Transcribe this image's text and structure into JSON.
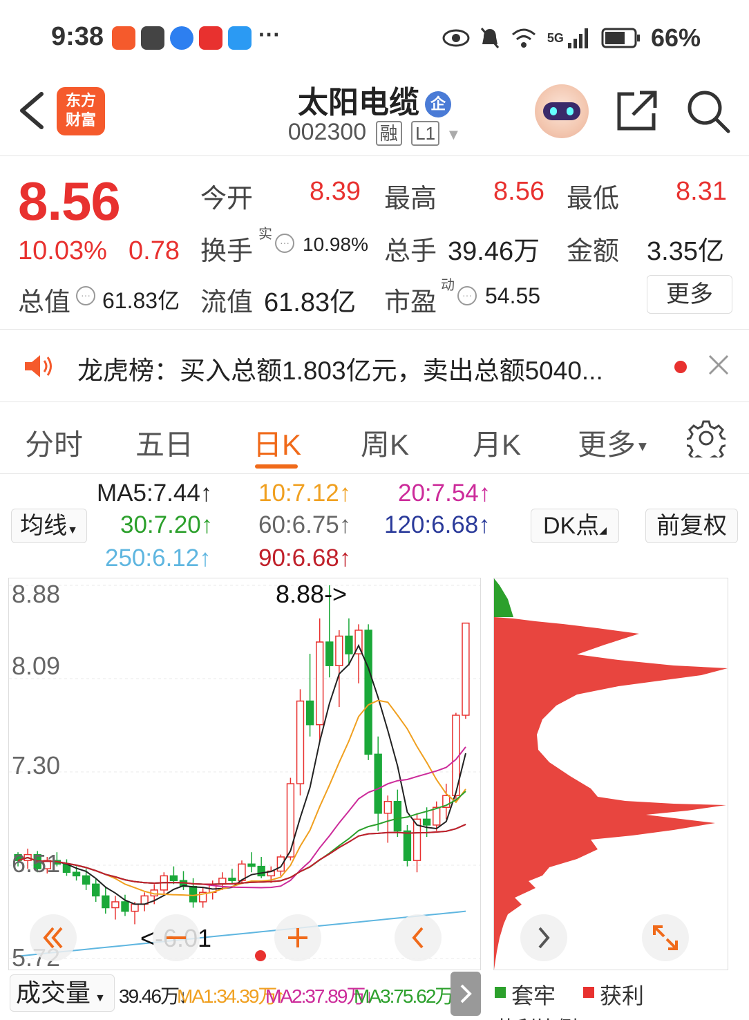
{
  "status_bar": {
    "time": "9:38",
    "battery": "66%",
    "network": "5G",
    "more": "···"
  },
  "header": {
    "app_logo_line1": "东方",
    "app_logo_line2": "财富",
    "stock_name": "太阳电缆",
    "enterprise_badge": "企",
    "stock_code": "002300",
    "margin_tag": "融",
    "level_tag": "L1"
  },
  "quote": {
    "price": "8.56",
    "change_pct": "10.03%",
    "change_amt": "0.78",
    "open_label": "今开",
    "open": "8.39",
    "high_label": "最高",
    "high": "8.56",
    "low_label": "最低",
    "low": "8.31",
    "turnover_label": "换手",
    "turnover_sup": "实",
    "turnover": "10.98%",
    "volume_label": "总手",
    "volume": "39.46万",
    "amount_label": "金额",
    "amount": "3.35亿",
    "total_cap_label": "总值",
    "total_cap": "61.83亿",
    "float_cap_label": "流值",
    "float_cap": "61.83亿",
    "pe_label": "市盈",
    "pe_sup": "动",
    "pe": "54.55",
    "more_label": "更多"
  },
  "news": {
    "text": "龙虎榜：买入总额1.803亿元，卖出总额5040..."
  },
  "tabs": [
    {
      "label": "分时"
    },
    {
      "label": "五日"
    },
    {
      "label": "日K"
    },
    {
      "label": "周K"
    },
    {
      "label": "月K"
    },
    {
      "label": "更多"
    }
  ],
  "indicators": {
    "ma_select": "均线",
    "ma5": "MA5:7.44↑",
    "ma10": "10:7.12↑",
    "ma20": "20:7.54↑",
    "ma30": "30:7.20↑",
    "ma60": "60:6.75↑",
    "ma120": "120:6.68↑",
    "ma250": "250:6.12↑",
    "ma90": "90:6.68↑",
    "dk_button": "DK点",
    "adjust_button": "前复权"
  },
  "colors": {
    "up": "#e8312f",
    "down": "#1aa839",
    "accent": "#f06a1a",
    "ma5": "#222222",
    "ma10": "#f0a020",
    "ma20": "#cc2b9a",
    "ma30": "#2ca02c",
    "ma60": "#666666",
    "ma120": "#2a3a9a",
    "ma250": "#5fb6e0",
    "ma90": "#c0202a"
  },
  "chart_data": {
    "type": "candlestick",
    "y_ticks": [
      "8.88",
      "8.09",
      "7.30",
      "6.51",
      "5.72"
    ],
    "ylim": [
      5.72,
      8.88
    ],
    "max_marker": "8.88->",
    "min_marker": "<-6.01",
    "candles": [
      [
        6.6,
        6.62,
        6.5,
        6.55
      ],
      [
        6.55,
        6.65,
        6.48,
        6.6
      ],
      [
        6.6,
        6.63,
        6.45,
        6.48
      ],
      [
        6.48,
        6.58,
        6.44,
        6.55
      ],
      [
        6.55,
        6.62,
        6.5,
        6.52
      ],
      [
        6.52,
        6.56,
        6.42,
        6.45
      ],
      [
        6.45,
        6.5,
        6.38,
        6.42
      ],
      [
        6.42,
        6.48,
        6.3,
        6.35
      ],
      [
        6.35,
        6.4,
        6.2,
        6.25
      ],
      [
        6.25,
        6.32,
        6.1,
        6.15
      ],
      [
        6.15,
        6.25,
        6.05,
        6.2
      ],
      [
        6.2,
        6.26,
        6.08,
        6.12
      ],
      [
        6.12,
        6.2,
        6.01,
        6.18
      ],
      [
        6.18,
        6.28,
        6.12,
        6.25
      ],
      [
        6.25,
        6.35,
        6.18,
        6.3
      ],
      [
        6.3,
        6.45,
        6.25,
        6.42
      ],
      [
        6.42,
        6.5,
        6.35,
        6.38
      ],
      [
        6.38,
        6.46,
        6.3,
        6.33
      ],
      [
        6.33,
        6.4,
        6.15,
        6.2
      ],
      [
        6.2,
        6.32,
        6.15,
        6.28
      ],
      [
        6.28,
        6.38,
        6.22,
        6.35
      ],
      [
        6.35,
        6.45,
        6.3,
        6.4
      ],
      [
        6.4,
        6.48,
        6.35,
        6.38
      ],
      [
        6.38,
        6.55,
        6.35,
        6.52
      ],
      [
        6.52,
        6.62,
        6.45,
        6.5
      ],
      [
        6.5,
        6.58,
        6.4,
        6.42
      ],
      [
        6.42,
        6.5,
        6.36,
        6.46
      ],
      [
        6.46,
        6.6,
        6.42,
        6.58
      ],
      [
        6.58,
        7.25,
        6.55,
        7.2
      ],
      [
        7.2,
        8.0,
        7.1,
        7.9
      ],
      [
        7.9,
        8.3,
        7.6,
        7.7
      ],
      [
        7.7,
        8.6,
        7.55,
        8.4
      ],
      [
        8.4,
        8.88,
        8.1,
        8.2
      ],
      [
        8.2,
        8.5,
        7.85,
        8.45
      ],
      [
        8.45,
        8.6,
        8.2,
        8.3
      ],
      [
        8.3,
        8.55,
        8.05,
        8.5
      ],
      [
        8.5,
        8.55,
        7.4,
        7.45
      ],
      [
        7.45,
        7.6,
        6.8,
        6.95
      ],
      [
        6.95,
        7.1,
        6.7,
        7.05
      ],
      [
        7.05,
        7.15,
        6.75,
        6.8
      ],
      [
        6.8,
        6.85,
        6.5,
        6.55
      ],
      [
        6.55,
        6.95,
        6.45,
        6.9
      ],
      [
        6.9,
        7.0,
        6.75,
        6.85
      ],
      [
        6.85,
        7.05,
        6.8,
        7.0
      ],
      [
        7.0,
        7.2,
        6.9,
        7.1
      ],
      [
        7.1,
        7.8,
        7.05,
        7.78
      ],
      [
        7.78,
        8.56,
        7.75,
        8.56
      ]
    ],
    "chip_legend": [
      "套牢",
      "获利"
    ],
    "chip_bottom_label": "获利比例"
  },
  "volume_bar": {
    "label": "成交量",
    "vol": "39.46万↓",
    "ma1": "MA1:34.39万↑",
    "ma2": "MA2:37.89万↓",
    "ma3": "MA3:75.62万↓"
  }
}
